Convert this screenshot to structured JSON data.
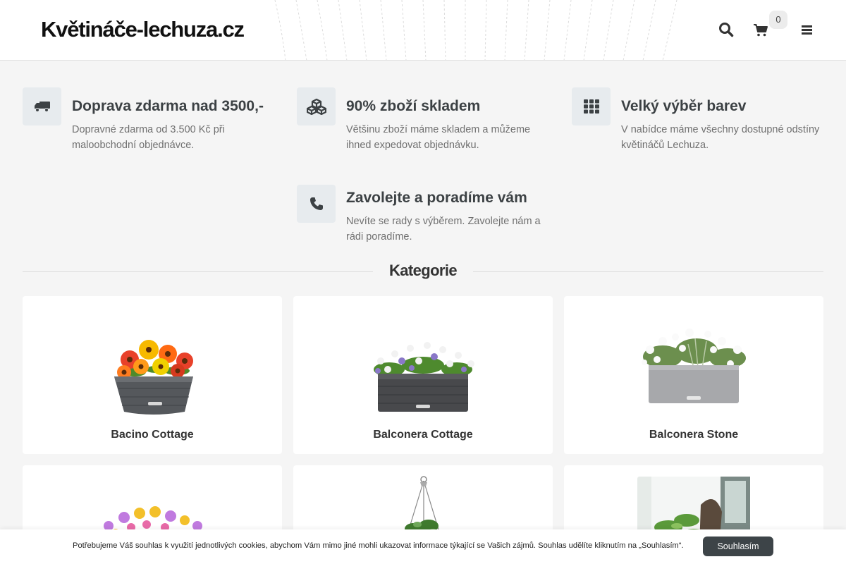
{
  "header": {
    "logo": "Květináče-lechuza.cz",
    "cart_count": "0",
    "icons": [
      "search-icon",
      "cart-icon",
      "menu-icon"
    ]
  },
  "features": [
    {
      "icon": "truck-icon",
      "title": "Doprava zdarma nad 3500,-",
      "desc": "Dopravné zdarma od 3.500 Kč při maloobchodní objednávce."
    },
    {
      "icon": "cubes-icon",
      "title": "90% zboží skladem",
      "desc": "Většinu zboží máme skladem a můžeme ihned expedovat objednávku."
    },
    {
      "icon": "grid-icon",
      "title": "Velký výběr barev",
      "desc": "V nabídce máme všechny dostupné odstíny květináčů Lechuza."
    },
    {
      "icon": "phone-icon",
      "title": "Zavolejte a poradíme vám",
      "desc": "Nevíte se rady s výběrem. Zavolejte nám a rádi poradíme."
    }
  ],
  "section": {
    "title": "Kategorie"
  },
  "categories": [
    {
      "name": "Bacino Cottage"
    },
    {
      "name": "Balconera Cottage"
    },
    {
      "name": "Balconera Stone"
    },
    {
      "name": ""
    },
    {
      "name": ""
    },
    {
      "name": ""
    }
  ],
  "cookie": {
    "text": "Potřebujeme Váš souhlas k využití jednotlivých cookies, abychom Vám mimo jiné mohli ukazovat informace týkající se Vašich zájmů. Souhlas udělíte kliknutím na „Souhlasím“.",
    "button": "Souhlasím"
  },
  "colors": {
    "accent": "#3d4448",
    "icon_bg": "#e7ebee",
    "title": "#3c4144",
    "desc": "#707070"
  }
}
